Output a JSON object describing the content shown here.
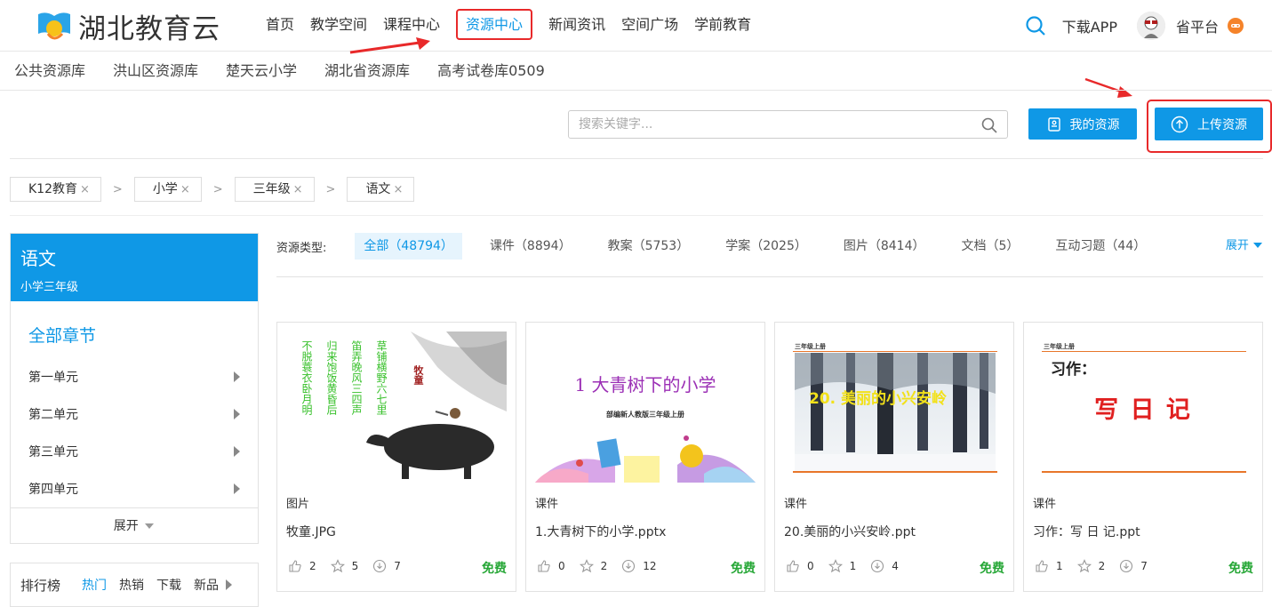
{
  "brand": {
    "name": "湖北教育云"
  },
  "nav": {
    "items": [
      "首页",
      "教学空间",
      "课程中心",
      "资源中心",
      "新闻资讯",
      "空间广场",
      "学前教育"
    ],
    "active_index": 3,
    "download_app": "下载APP",
    "platform": "省平台"
  },
  "subnav": {
    "items": [
      "公共资源库",
      "洪山区资源库",
      "楚天云小学",
      "湖北省资源库",
      "高考试卷库0509"
    ]
  },
  "search": {
    "placeholder": "搜索关键字..."
  },
  "buttons": {
    "my_resources": "我的资源",
    "upload": "上传资源"
  },
  "breadcrumb": {
    "items": [
      "K12教育",
      "小学",
      "三年级",
      "语文"
    ],
    "remove": "×",
    "separator": ">"
  },
  "sidebar": {
    "subject": "语文",
    "grade": "小学三年级",
    "all_chapters": "全部章节",
    "units": [
      "第一单元",
      "第二单元",
      "第三单元",
      "第四单元"
    ],
    "expand": "展开"
  },
  "ranking": {
    "title": "排行榜",
    "tabs": [
      "热门",
      "热销",
      "下载",
      "新品"
    ],
    "active_tab": 0
  },
  "resource_types": {
    "label": "资源类型:",
    "items": [
      "全部（48794）",
      "课件（8894）",
      "教案（5753）",
      "学案（2025）",
      "图片（8414）",
      "文档（5）",
      "互动习题（44）"
    ],
    "active_index": 0,
    "expand": "展开"
  },
  "cards": [
    {
      "type": "图片",
      "name": "牧童.JPG",
      "likes": "2",
      "stars": "5",
      "downloads": "7",
      "price": "免费",
      "thumb": {
        "title": "牧童",
        "poem": [
          "草铺横野六七里",
          "笛弄晚风三四声",
          "归来饱饭黄昏后",
          "不脱蓑衣卧月明"
        ]
      }
    },
    {
      "type": "课件",
      "name": "1.大青树下的小学.pptx",
      "likes": "0",
      "stars": "2",
      "downloads": "12",
      "price": "免费",
      "thumb": {
        "title": "1 大青树下的小学",
        "subtitle": "部编新人教版三年级上册"
      }
    },
    {
      "type": "课件",
      "name": "20.美丽的小兴安岭.ppt",
      "likes": "0",
      "stars": "1",
      "downloads": "4",
      "price": "免费",
      "thumb": {
        "header": "三年级上册",
        "title": "20. 美丽的小兴安岭"
      }
    },
    {
      "type": "课件",
      "name": "习作：写 日 记.ppt",
      "likes": "1",
      "stars": "2",
      "downloads": "7",
      "price": "免费",
      "thumb": {
        "header": "三年级上册",
        "label": "习作：",
        "title": "写 日 记"
      }
    }
  ],
  "colors": {
    "accent": "#0f98e6",
    "highlight": "#e8292a",
    "free": "#27a737"
  }
}
